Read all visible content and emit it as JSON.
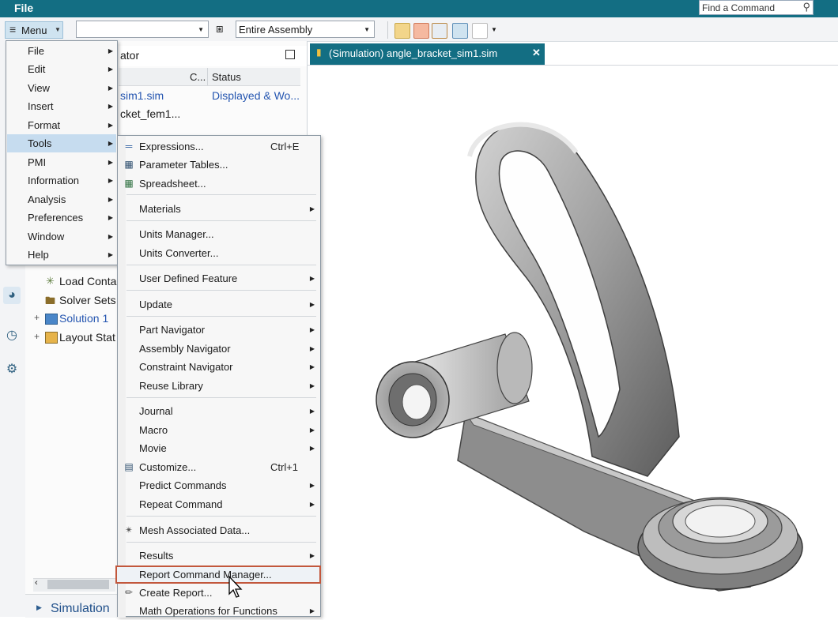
{
  "titlebar": {
    "file_label": "File",
    "find_command": "Find a Command"
  },
  "toolbar": {
    "menu_label": "Menu",
    "filter_value": "",
    "scope_value": "Entire Assembly"
  },
  "navigator": {
    "title_fragment": "ator",
    "columns": [
      "C...",
      "Status"
    ],
    "rows": [
      {
        "name": "sim1.sim",
        "status": "Displayed & Wo..."
      },
      {
        "name": "cket_fem1...",
        "status": ""
      }
    ],
    "tree": [
      "Load Conta",
      "Solver Sets",
      "Solution 1",
      "Layout Stat"
    ],
    "bottom_label": "Simulation"
  },
  "document_tab": {
    "title": "(Simulation) angle_bracket_sim1.sim"
  },
  "main_menu": [
    {
      "label": "File"
    },
    {
      "label": "Edit"
    },
    {
      "label": "View"
    },
    {
      "label": "Insert"
    },
    {
      "label": "Format"
    },
    {
      "label": "Tools"
    },
    {
      "label": "PMI"
    },
    {
      "label": "Information"
    },
    {
      "label": "Analysis"
    },
    {
      "label": "Preferences"
    },
    {
      "label": "Window"
    },
    {
      "label": "Help"
    }
  ],
  "tools_menu": [
    {
      "label": "Expressions...",
      "shortcut": "Ctrl+E"
    },
    {
      "label": "Parameter Tables..."
    },
    {
      "label": "Spreadsheet..."
    },
    {
      "label": "Materials"
    },
    {
      "label": "Units Manager..."
    },
    {
      "label": "Units Converter..."
    },
    {
      "label": "User Defined Feature"
    },
    {
      "label": "Update"
    },
    {
      "label": "Part Navigator"
    },
    {
      "label": "Assembly Navigator"
    },
    {
      "label": "Constraint Navigator"
    },
    {
      "label": "Reuse Library"
    },
    {
      "label": "Journal"
    },
    {
      "label": "Macro"
    },
    {
      "label": "Movie"
    },
    {
      "label": "Customize...",
      "shortcut": "Ctrl+1"
    },
    {
      "label": "Predict Commands"
    },
    {
      "label": "Repeat Command"
    },
    {
      "label": "Mesh Associated Data..."
    },
    {
      "label": "Results"
    },
    {
      "label": "Report Command Manager..."
    },
    {
      "label": "Create Report..."
    },
    {
      "label": "Math Operations for Functions"
    }
  ],
  "colors": {
    "titlebar": "#136e83",
    "highlight": "#c2573c",
    "selection": "#c6dcef"
  }
}
